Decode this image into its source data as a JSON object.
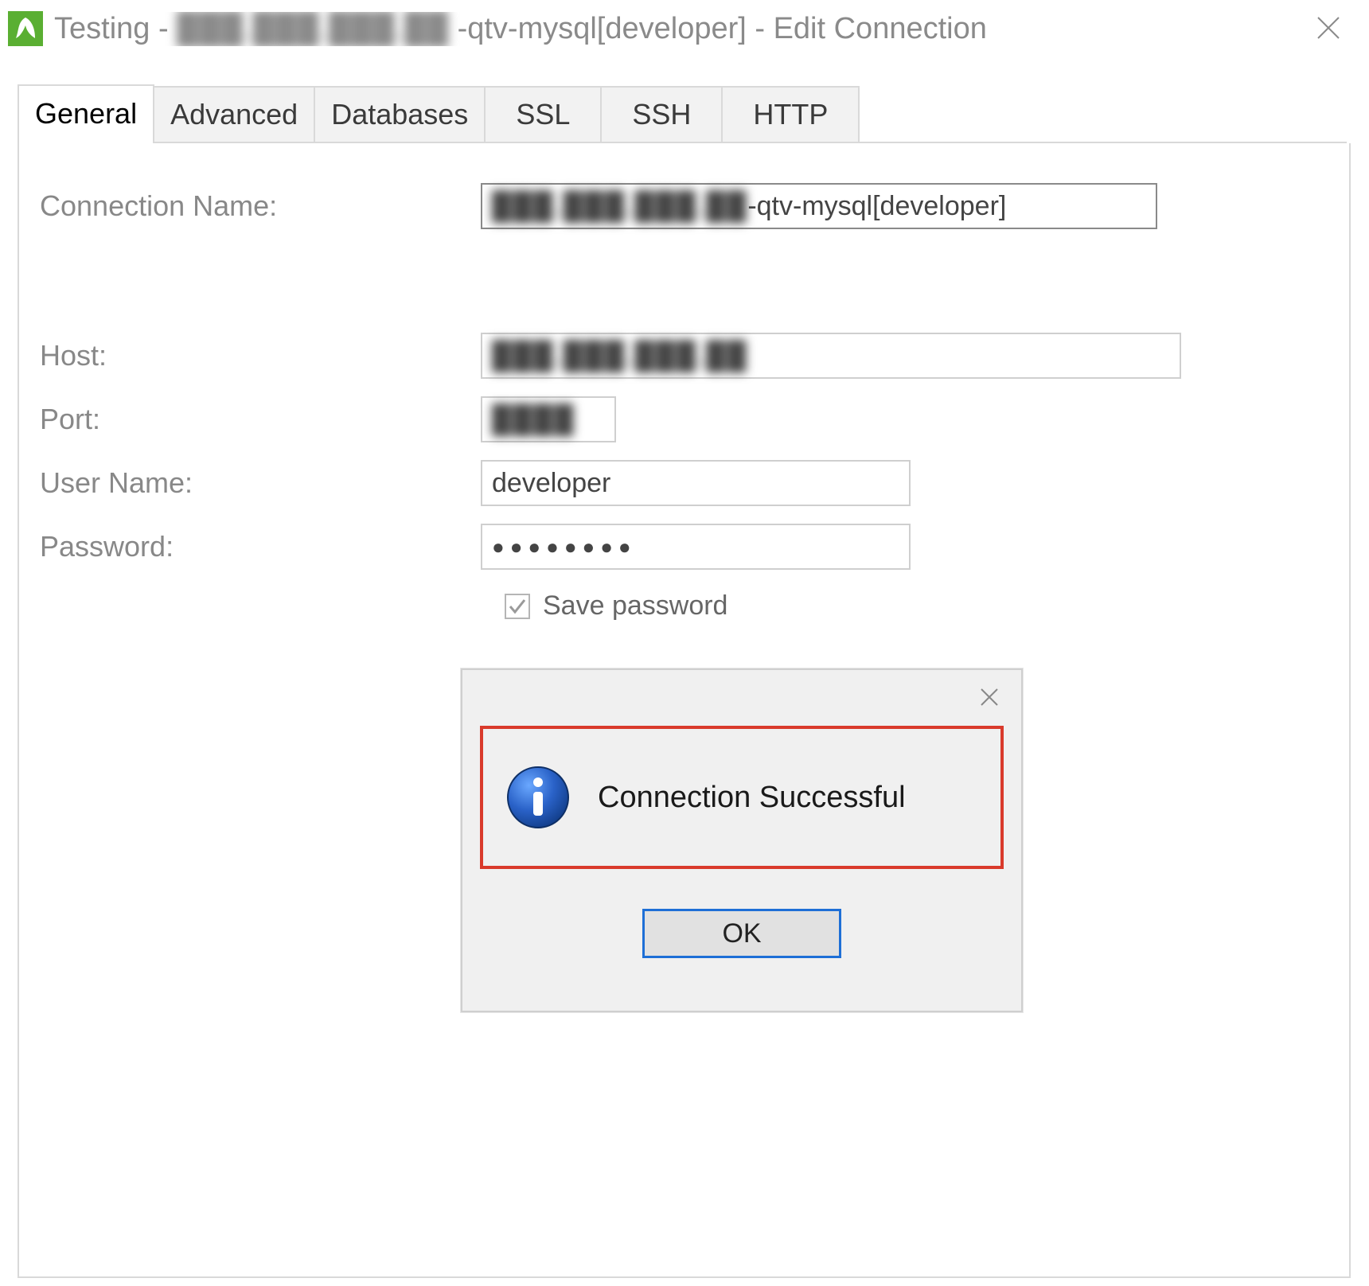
{
  "window": {
    "title_prefix": "Testing - ",
    "title_masked": "███.███.███.██",
    "title_suffix": "-qtv-mysql[developer] - Edit Connection"
  },
  "tabs": [
    {
      "label": "General",
      "active": true
    },
    {
      "label": "Advanced",
      "active": false
    },
    {
      "label": "Databases",
      "active": false
    },
    {
      "label": "SSL",
      "active": false
    },
    {
      "label": "SSH",
      "active": false
    },
    {
      "label": "HTTP",
      "active": false
    }
  ],
  "form": {
    "connection_name": {
      "label": "Connection Name:",
      "masked_prefix": "███.███.███.██",
      "suffix": "-qtv-mysql[developer]"
    },
    "host": {
      "label": "Host:",
      "masked": "███.███.███.██"
    },
    "port": {
      "label": "Port:",
      "masked": "████"
    },
    "user": {
      "label": "User Name:",
      "value": "developer"
    },
    "password": {
      "label": "Password:",
      "mask": "●●●●●●●●"
    },
    "save_password": {
      "label": "Save password",
      "checked": true
    }
  },
  "dialog": {
    "message": "Connection Successful",
    "ok_label": "OK"
  }
}
